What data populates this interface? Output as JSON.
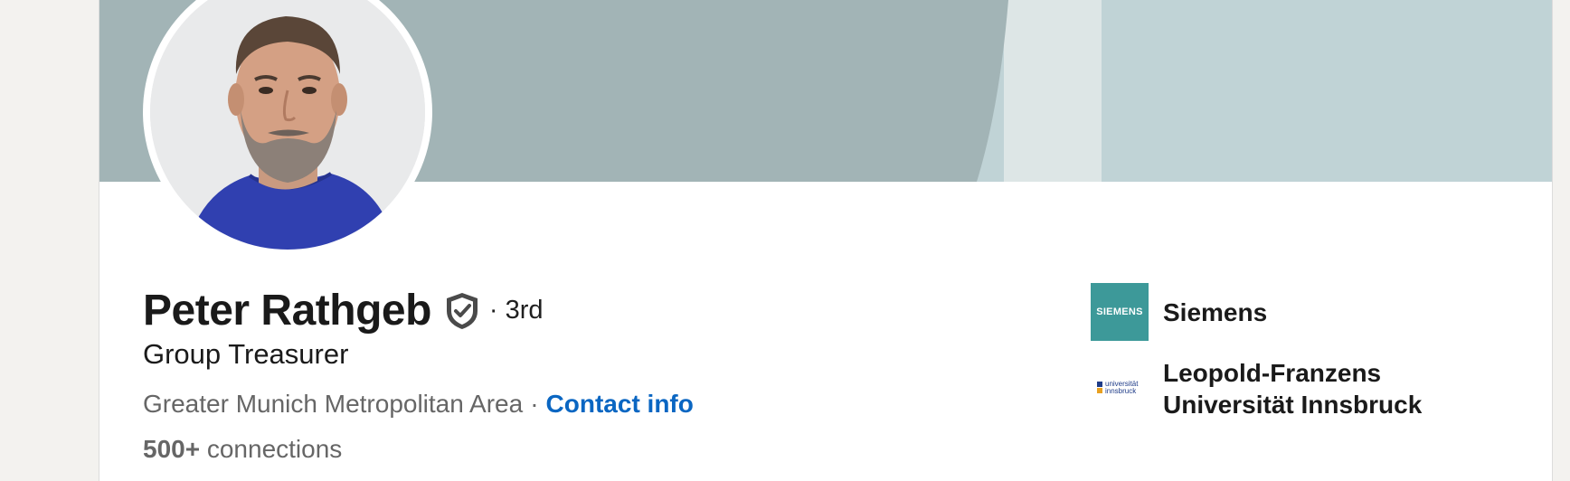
{
  "profile": {
    "name": "Peter Rathgeb",
    "degree": "· 3rd",
    "headline": "Group Treasurer",
    "location": "Greater Munich Metropolitan Area",
    "separator": "·",
    "contact_info_label": "Contact info",
    "connections_count": "500+",
    "connections_label": "connections"
  },
  "organizations": [
    {
      "name": "Siemens",
      "logo_text": "SIEMENS",
      "logo_color": "#3d9999"
    },
    {
      "name_line1": "Leopold-Franzens",
      "name_line2": "Universität Innsbruck",
      "logo_line1": "universität",
      "logo_line2": "innsbruck"
    }
  ],
  "colors": {
    "banner_dark": "#a2b4b6",
    "banner_mid": "#dde6e6",
    "banner_light": "#c0d3d6",
    "link": "#0a66c2",
    "shirt": "#3040b0"
  },
  "icons": {
    "verified": "verified-shield-icon"
  }
}
